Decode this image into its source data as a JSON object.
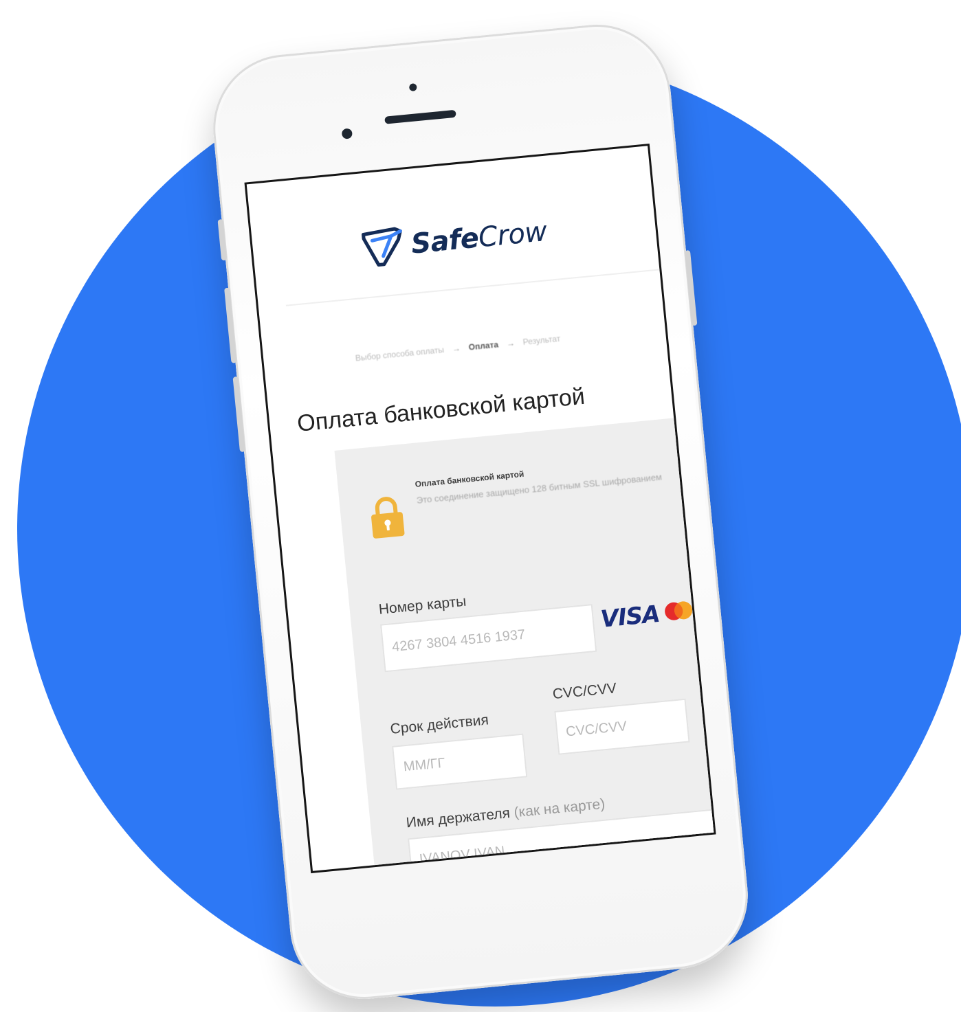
{
  "logo": {
    "brand_strong": "Safe",
    "brand_light": "Crow",
    "icon": "safecrow-shield-logo"
  },
  "steps": {
    "step1": "Выбор способа оплаты",
    "arrow": "→",
    "step2": "Оплата",
    "step3": "Результат"
  },
  "page": {
    "title": "Оплата банковской картой"
  },
  "security": {
    "title": "Оплата банковской картой",
    "text": "Это соединение защищено 128 битным SSL шифрованием",
    "icon": "lock-icon",
    "icon_color": "#f0b43c"
  },
  "form": {
    "card_number": {
      "label": "Номер карты",
      "value": "4267 3804 4516 1937"
    },
    "card_brands": {
      "visa": "VISA",
      "mastercard_icon": "mastercard-icon"
    },
    "expiry": {
      "label": "Срок действия",
      "placeholder": "ММ/ГГ"
    },
    "cvc": {
      "label": "CVC/CVV",
      "placeholder": "CVC/CVV"
    },
    "holder": {
      "label": "Имя держателя",
      "label_hint": "(как на карте)",
      "placeholder": "IVANOV IVAN"
    }
  },
  "colors": {
    "background_circle": "#2d78f5",
    "brand_navy": "#142c57",
    "visa_blue": "#1a2d7c"
  }
}
